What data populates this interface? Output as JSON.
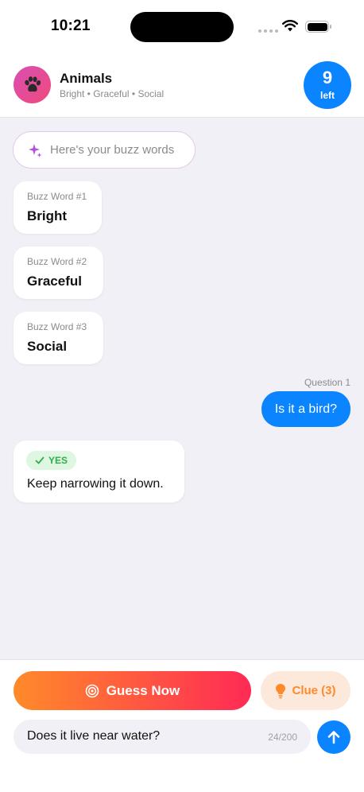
{
  "status": {
    "time": "10:21"
  },
  "header": {
    "title": "Animals",
    "subtitle": "Bright • Graceful • Social",
    "remaining_count": "9",
    "remaining_label": "left",
    "avatar_icon": "paw-icon",
    "avatar_colors": [
      "#d94fb2",
      "#ef4a7c"
    ]
  },
  "chat": {
    "intro": "Here's your buzz words",
    "buzz_words": [
      {
        "label": "Buzz Word #1",
        "value": "Bright"
      },
      {
        "label": "Buzz Word #2",
        "value": "Graceful"
      },
      {
        "label": "Buzz Word #3",
        "value": "Social"
      }
    ],
    "question_label": "Question 1",
    "question": "Is it a bird?",
    "answer_badge": "YES",
    "answer_text": "Keep narrowing it down."
  },
  "actions": {
    "guess_label": "Guess Now",
    "clue_label": "Clue (3)",
    "input_value": "Does it live near water?",
    "char_count": "24/200"
  },
  "colors": {
    "accent": "#0a84ff",
    "guess_gradient": [
      "#ff8a2a",
      "#ff2a55"
    ],
    "clue_bg": "#fde8dc",
    "clue_text": "#ff8a2a",
    "yes_bg": "#def6e2",
    "yes_text": "#2fae4b",
    "background": "#f1f0f6"
  }
}
